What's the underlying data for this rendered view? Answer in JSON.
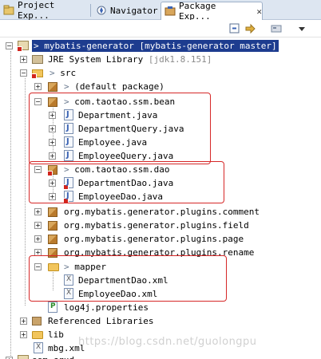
{
  "tabs": [
    {
      "label": "Project Exp...",
      "active": false
    },
    {
      "label": "Navigator",
      "active": false
    },
    {
      "label": "Package Exp...",
      "active": true,
      "close": "✕"
    }
  ],
  "toolbar": {
    "icons": [
      "collapse-all-icon",
      "link-with-editor-icon",
      "view-menu-icon",
      "chevron-down-icon"
    ]
  },
  "tree": {
    "project_root": {
      "prefix": "> ",
      "label": "mybatis-generator [mybatis-generator master]"
    },
    "jre": {
      "label": "JRE System Library",
      "suffix": " [jdk1.8.151]"
    },
    "src": {
      "label": "src",
      "prefix": "> "
    },
    "default_package": {
      "label": "(default package)",
      "prefix": "> "
    },
    "pkg_bean": {
      "label": "com.taotao.ssm.bean",
      "prefix": "> "
    },
    "bean_files": [
      "Department.java",
      "DepartmentQuery.java",
      "Employee.java",
      "EmployeeQuery.java"
    ],
    "pkg_dao": {
      "label": "com.taotao.ssm.dao",
      "prefix": "> "
    },
    "dao_files": [
      "DepartmentDao.java",
      "EmployeeDao.java"
    ],
    "plugin_packages": [
      "org.mybatis.generator.plugins.comment",
      "org.mybatis.generator.plugins.field",
      "org.mybatis.generator.plugins.page",
      "org.mybatis.generator.plugins.rename"
    ],
    "mapper": {
      "label": "mapper",
      "prefix": "> "
    },
    "mapper_files": [
      "DepartmentDao.xml",
      "EmployeeDao.xml"
    ],
    "log4j": "log4j.properties",
    "referenced": "Referenced Libraries",
    "lib": "lib",
    "mbg": "mbg.xml",
    "ssm_crud": "ssm-crud"
  },
  "watermark": "https://blog.csdn.net/guolongpu",
  "colors": {
    "selection": "#1d3c8f",
    "highlight_box": "#d62828",
    "tab_bar": "#dde6f1"
  }
}
